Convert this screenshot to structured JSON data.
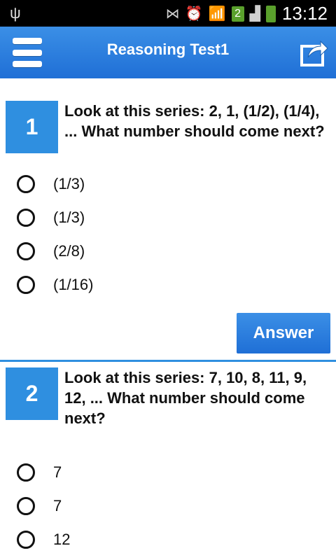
{
  "status_bar": {
    "usb_icon": "usb-icon",
    "sim_badge": "2",
    "time": "13:12"
  },
  "app_bar": {
    "title": "Reasoning Test1",
    "menu_icon": "menu-icon",
    "share_icon": "share-icon"
  },
  "questions": [
    {
      "number": "1",
      "text": "Look at this series: 2, 1, (1/2), (1/4), ... What number should come next?",
      "options": [
        "(1/3)",
        "(1/3)",
        "(2/8)",
        "(1/16)"
      ]
    },
    {
      "number": "2",
      "text": "Look at this series: 7, 10, 8, 11, 9, 12, ... What number should come next?",
      "options": [
        "7",
        "7",
        "12"
      ]
    }
  ],
  "answer_button": {
    "label": "Answer"
  },
  "colors": {
    "accent": "#2f8fe0",
    "app_bar": "#1f6fd6",
    "status_bar": "#000000"
  }
}
